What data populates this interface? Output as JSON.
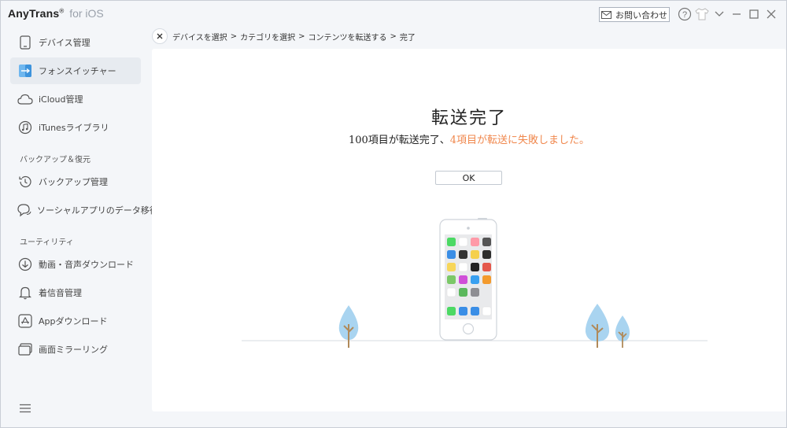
{
  "titlebar": {
    "brand": "AnyTrans",
    "reg": "®",
    "suffix": "for iOS",
    "contact_label": "お問い合わせ"
  },
  "sidebar": {
    "items": [
      {
        "label": "デバイス管理",
        "icon": "phone-icon"
      },
      {
        "label": "フォンスイッチャー",
        "icon": "phone-switcher-icon",
        "active": true
      },
      {
        "label": "iCloud管理",
        "icon": "cloud-icon"
      },
      {
        "label": "iTunesライブラリ",
        "icon": "music-note-icon"
      }
    ],
    "section_backup": "バックアップ＆復元",
    "backup_items": [
      {
        "label": "バックアップ管理",
        "icon": "history-icon"
      },
      {
        "label": "ソーシャルアプリのデータ移行",
        "icon": "chat-bubbles-icon"
      }
    ],
    "section_utility": "ユーティリティ",
    "utility_items": [
      {
        "label": "動画・音声ダウンロード",
        "icon": "download-icon"
      },
      {
        "label": "着信音管理",
        "icon": "bell-icon"
      },
      {
        "label": "Appダウンロード",
        "icon": "app-store-icon"
      },
      {
        "label": "画面ミラーリング",
        "icon": "mirror-screen-icon"
      }
    ]
  },
  "breadcrumb": {
    "steps": [
      "デバイスを選択",
      "カテゴリを選択",
      "コンテンツを転送する",
      "完了"
    ],
    "separator": ">"
  },
  "main": {
    "title": "転送完了",
    "message_success": "100項目が転送完了、",
    "message_fail": "4項目が転送に失敗しました。",
    "ok_label": "OK"
  },
  "colors": {
    "accent_fail": "#f0874c",
    "active_bg": "#e7ebf0",
    "tree": "#a9d4f0"
  }
}
